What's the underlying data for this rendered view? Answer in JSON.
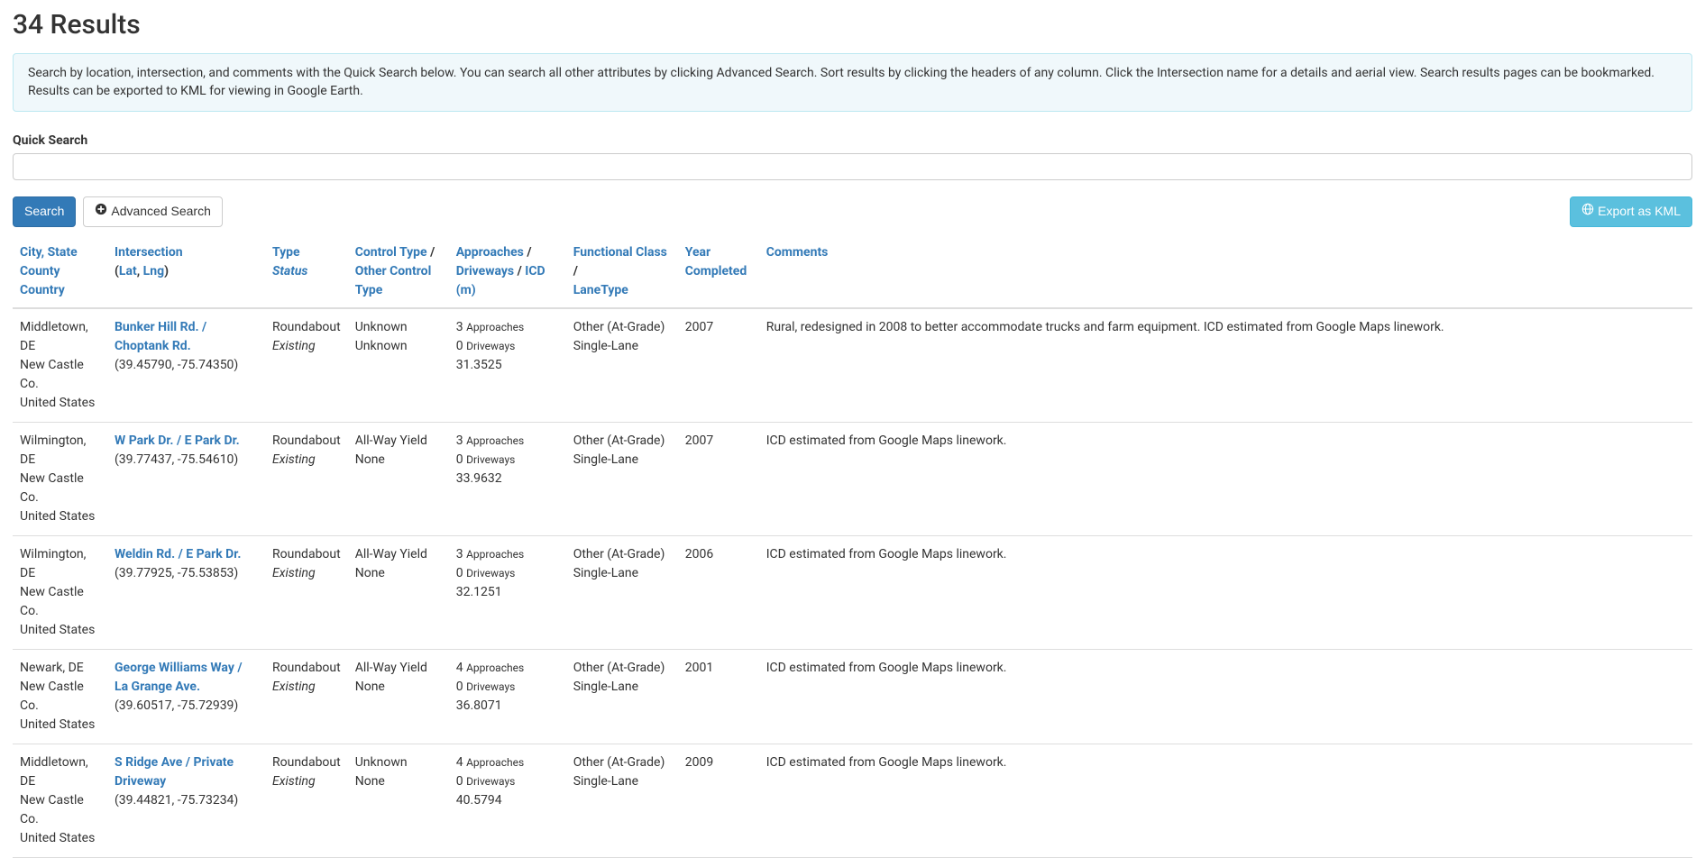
{
  "page_title": "34 Results",
  "info_text": "Search by location, intersection, and comments with the Quick Search below. You can search all other attributes by clicking Advanced Search. Sort results by clicking the headers of any column. Click the Intersection name for a details and aerial view. Search results pages can be bookmarked. Results can be exported to KML for viewing in Google Earth.",
  "quick_search_label": "Quick Search",
  "quick_search_value": "",
  "buttons": {
    "search": "Search",
    "advanced_search": "Advanced Search",
    "export_kml": "Export as KML"
  },
  "headers": {
    "city_state": "City, State",
    "county": "County",
    "country": "Country",
    "intersection": "Intersection",
    "lat": "Lat",
    "lng": "Lng",
    "type": "Type",
    "status": "Status",
    "control_type": "Control Type",
    "other_control_type": "Other Control Type",
    "approaches": "Approaches",
    "driveways": "Driveways",
    "icd_m": "ICD (m)",
    "functional_class": "Functional Class",
    "lane_type": "LaneType",
    "year_completed": "Year Completed",
    "comments": "Comments"
  },
  "subs": {
    "approaches": "Approaches",
    "driveways": "Driveways"
  },
  "rows": [
    {
      "city_state": "Middletown, DE",
      "county": "New Castle Co.",
      "country": "United States",
      "intersection": "Bunker Hill Rd. / Choptank Rd.",
      "latlng": "(39.45790, -75.74350)",
      "type": "Roundabout",
      "status": "Existing",
      "control_type": "Unknown",
      "other_control_type": "Unknown",
      "approaches": "3",
      "driveways": "0",
      "icd": "31.3525",
      "functional_class": "Other (At-Grade)",
      "lane_type": "Single-Lane",
      "year": "2007",
      "comments": "Rural, redesigned in 2008 to better accommodate trucks and farm equipment. ICD estimated from Google Maps linework."
    },
    {
      "city_state": "Wilmington, DE",
      "county": "New Castle Co.",
      "country": "United States",
      "intersection": "W Park Dr. / E Park Dr.",
      "latlng": "(39.77437, -75.54610)",
      "type": "Roundabout",
      "status": "Existing",
      "control_type": "All-Way Yield",
      "other_control_type": "None",
      "approaches": "3",
      "driveways": "0",
      "icd": "33.9632",
      "functional_class": "Other (At-Grade)",
      "lane_type": "Single-Lane",
      "year": "2007",
      "comments": "ICD estimated from Google Maps linework."
    },
    {
      "city_state": "Wilmington, DE",
      "county": "New Castle Co.",
      "country": "United States",
      "intersection": "Weldin Rd. / E Park Dr.",
      "latlng": "(39.77925, -75.53853)",
      "type": "Roundabout",
      "status": "Existing",
      "control_type": "All-Way Yield",
      "other_control_type": "None",
      "approaches": "3",
      "driveways": "0",
      "icd": "32.1251",
      "functional_class": "Other (At-Grade)",
      "lane_type": "Single-Lane",
      "year": "2006",
      "comments": "ICD estimated from Google Maps linework."
    },
    {
      "city_state": "Newark, DE",
      "county": "New Castle Co.",
      "country": "United States",
      "intersection": "George Williams Way / La Grange Ave.",
      "latlng": "(39.60517, -75.72939)",
      "type": "Roundabout",
      "status": "Existing",
      "control_type": "All-Way Yield",
      "other_control_type": "None",
      "approaches": "4",
      "driveways": "0",
      "icd": "36.8071",
      "functional_class": "Other (At-Grade)",
      "lane_type": "Single-Lane",
      "year": "2001",
      "comments": "ICD estimated from Google Maps linework."
    },
    {
      "city_state": "Middletown, DE",
      "county": "New Castle Co.",
      "country": "United States",
      "intersection": "S Ridge Ave / Private Driveway",
      "latlng": "(39.44821, -75.73234)",
      "type": "Roundabout",
      "status": "Existing",
      "control_type": "Unknown",
      "other_control_type": "None",
      "approaches": "4",
      "driveways": "0",
      "icd": "40.5794",
      "functional_class": "Other (At-Grade)",
      "lane_type": "Single-Lane",
      "year": "2009",
      "comments": "ICD estimated from Google Maps linework."
    }
  ]
}
